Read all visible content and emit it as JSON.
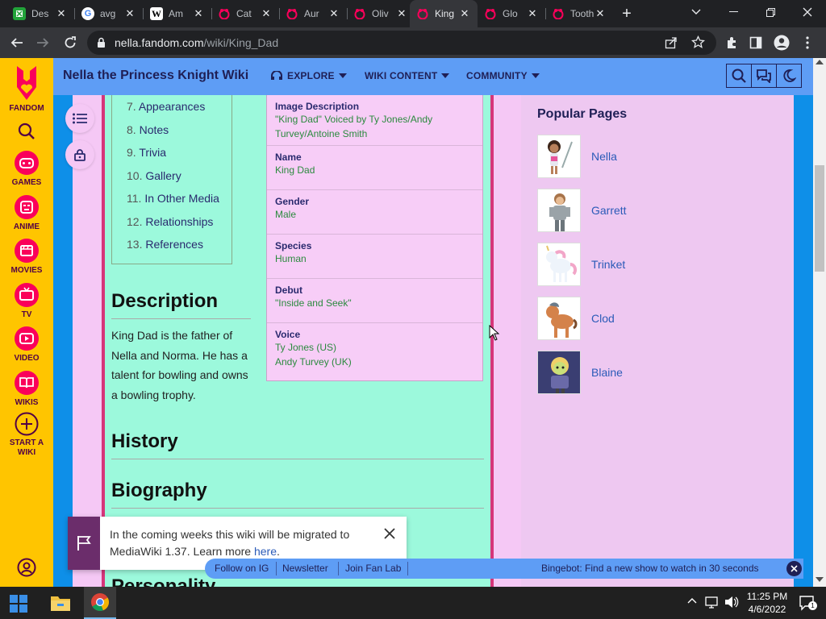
{
  "browser": {
    "tabs": [
      {
        "title": "Des",
        "favicon": "puzzle-icon",
        "color": "#22a33a"
      },
      {
        "title": "avg",
        "favicon": "google-icon",
        "color": "#4285f4"
      },
      {
        "title": "Am",
        "favicon": "wikipedia-icon",
        "color": "#ffffff"
      },
      {
        "title": "Cat",
        "favicon": "fandom-icon",
        "color": "#fa005a"
      },
      {
        "title": "Aur",
        "favicon": "fandom-icon",
        "color": "#fa005a"
      },
      {
        "title": "Oliv",
        "favicon": "fandom-icon",
        "color": "#fa005a"
      },
      {
        "title": "King",
        "favicon": "fandom-icon",
        "color": "#fa005a",
        "active": true
      },
      {
        "title": "Glo",
        "favicon": "fandom-icon",
        "color": "#fa005a"
      },
      {
        "title": "Toothle",
        "favicon": "fandom-icon",
        "color": "#fa005a"
      }
    ],
    "url_host": "nella.fandom.com",
    "url_path": "/wiki/King_Dad"
  },
  "rail": {
    "brand": "FANDOM",
    "items": [
      "GAMES",
      "ANIME",
      "MOVIES",
      "TV",
      "VIDEO",
      "WIKIS"
    ],
    "start_line1": "START A",
    "start_line2": "WIKI"
  },
  "header": {
    "wiki_name": "Nella the Princess Knight Wiki",
    "nav": [
      "EXPLORE",
      "WIKI CONTENT",
      "COMMUNITY"
    ]
  },
  "toc": {
    "items": [
      {
        "num": "7.",
        "label": "Appearances"
      },
      {
        "num": "8.",
        "label": "Notes"
      },
      {
        "num": "9.",
        "label": "Trivia"
      },
      {
        "num": "10.",
        "label": "Gallery"
      },
      {
        "num": "11.",
        "label": "In Other Media"
      },
      {
        "num": "12.",
        "label": "Relationships"
      },
      {
        "num": "13.",
        "label": "References"
      }
    ]
  },
  "infobox": {
    "rows": [
      {
        "label": "Image Description",
        "value": "\"King Dad\" Voiced by Ty Jones/Andy Turvey/Antoine Smith"
      },
      {
        "label": "Name",
        "value": "King Dad"
      },
      {
        "label": "Gender",
        "value": "Male"
      },
      {
        "label": "Species",
        "value": "Human"
      },
      {
        "label": "Debut",
        "value": "\"Inside and Seek\""
      },
      {
        "label": "Voice",
        "value": "Ty Jones (US)",
        "value2": "Andy Turvey (UK)"
      }
    ]
  },
  "article": {
    "description_heading": "Description",
    "description_text": "King Dad is the father of Nella and Norma. He has a talent for bowling and owns a bowling trophy.",
    "history_heading": "History",
    "biography_heading": "Biography",
    "personality_heading": "Personality"
  },
  "popular": {
    "title": "Popular Pages",
    "items": [
      "Nella",
      "Garrett",
      "Trinket",
      "Clod",
      "Blaine"
    ]
  },
  "notification": {
    "text": "In the coming weeks this wiki will be migrated to MediaWiki 1.37. Learn more ",
    "link": "here",
    "end": "."
  },
  "bottombar": {
    "links": [
      "Follow on IG",
      "Newsletter",
      "Join Fan Lab"
    ],
    "bingebot": "Bingebot: Find a new show to watch in 30 seconds"
  },
  "taskbar": {
    "time": "11:25 PM",
    "date": "4/6/2022",
    "notification_count": "1"
  }
}
